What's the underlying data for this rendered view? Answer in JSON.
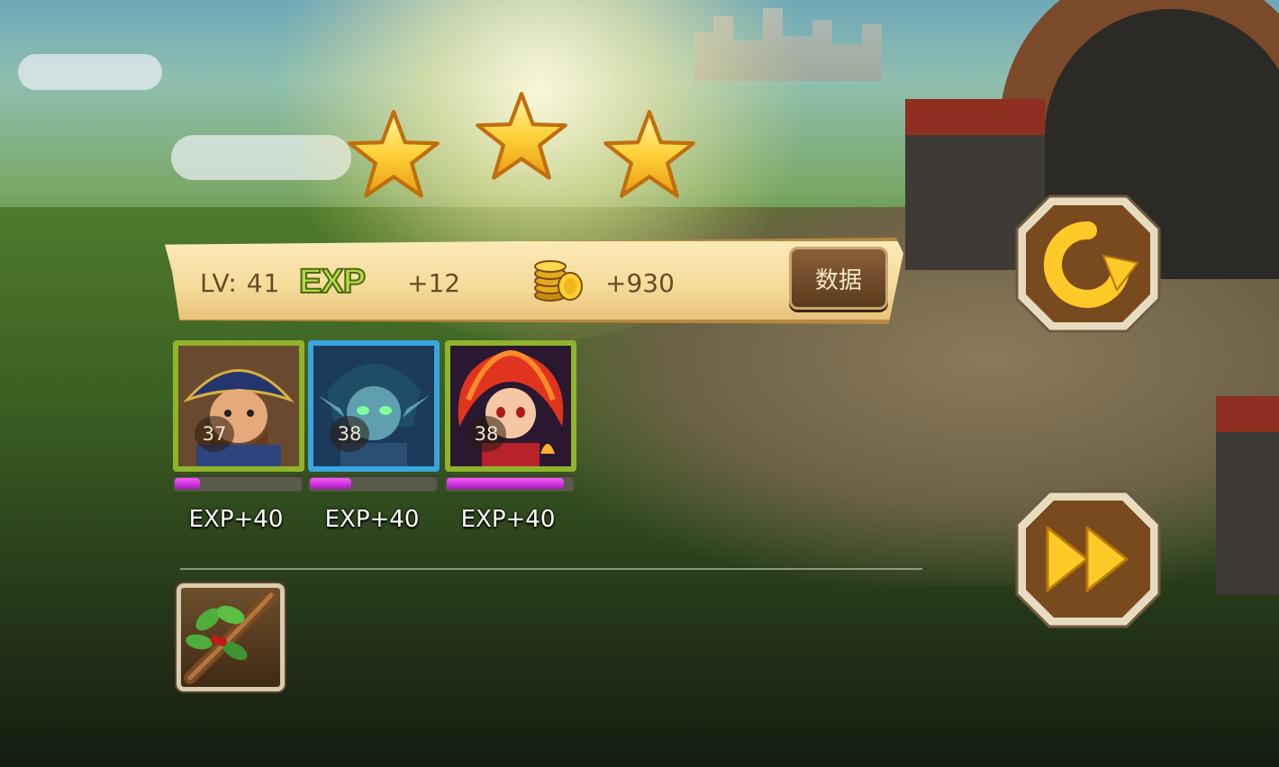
{
  "result": {
    "stars_earned": 3,
    "stars_total": 3
  },
  "summary": {
    "level_text": "LV: 41",
    "exp_badge": "EXP",
    "exp_gain": "+12",
    "gold_gain": "+930",
    "data_button_label": "数据"
  },
  "heroes": [
    {
      "level": "37",
      "exp_gain": "EXP+40",
      "exp_progress": 0.2,
      "frame_color": "#8fb32c"
    },
    {
      "level": "38",
      "exp_gain": "EXP+40",
      "exp_progress": 0.33,
      "frame_color": "#3aa6df"
    },
    {
      "level": "38",
      "exp_gain": "EXP+40",
      "exp_progress": 0.93,
      "frame_color": "#8fb32c"
    }
  ],
  "loot": [
    {
      "icon": "leafy-branch-icon"
    }
  ],
  "buttons": {
    "replay_icon": "replay-icon",
    "next_icon": "fast-forward-icon"
  },
  "colors": {
    "star_gold": "#ffd23a",
    "banner": "#f6dc9c",
    "exp_bar": "#d93bd9",
    "button_brown": "#7a4a1f"
  }
}
